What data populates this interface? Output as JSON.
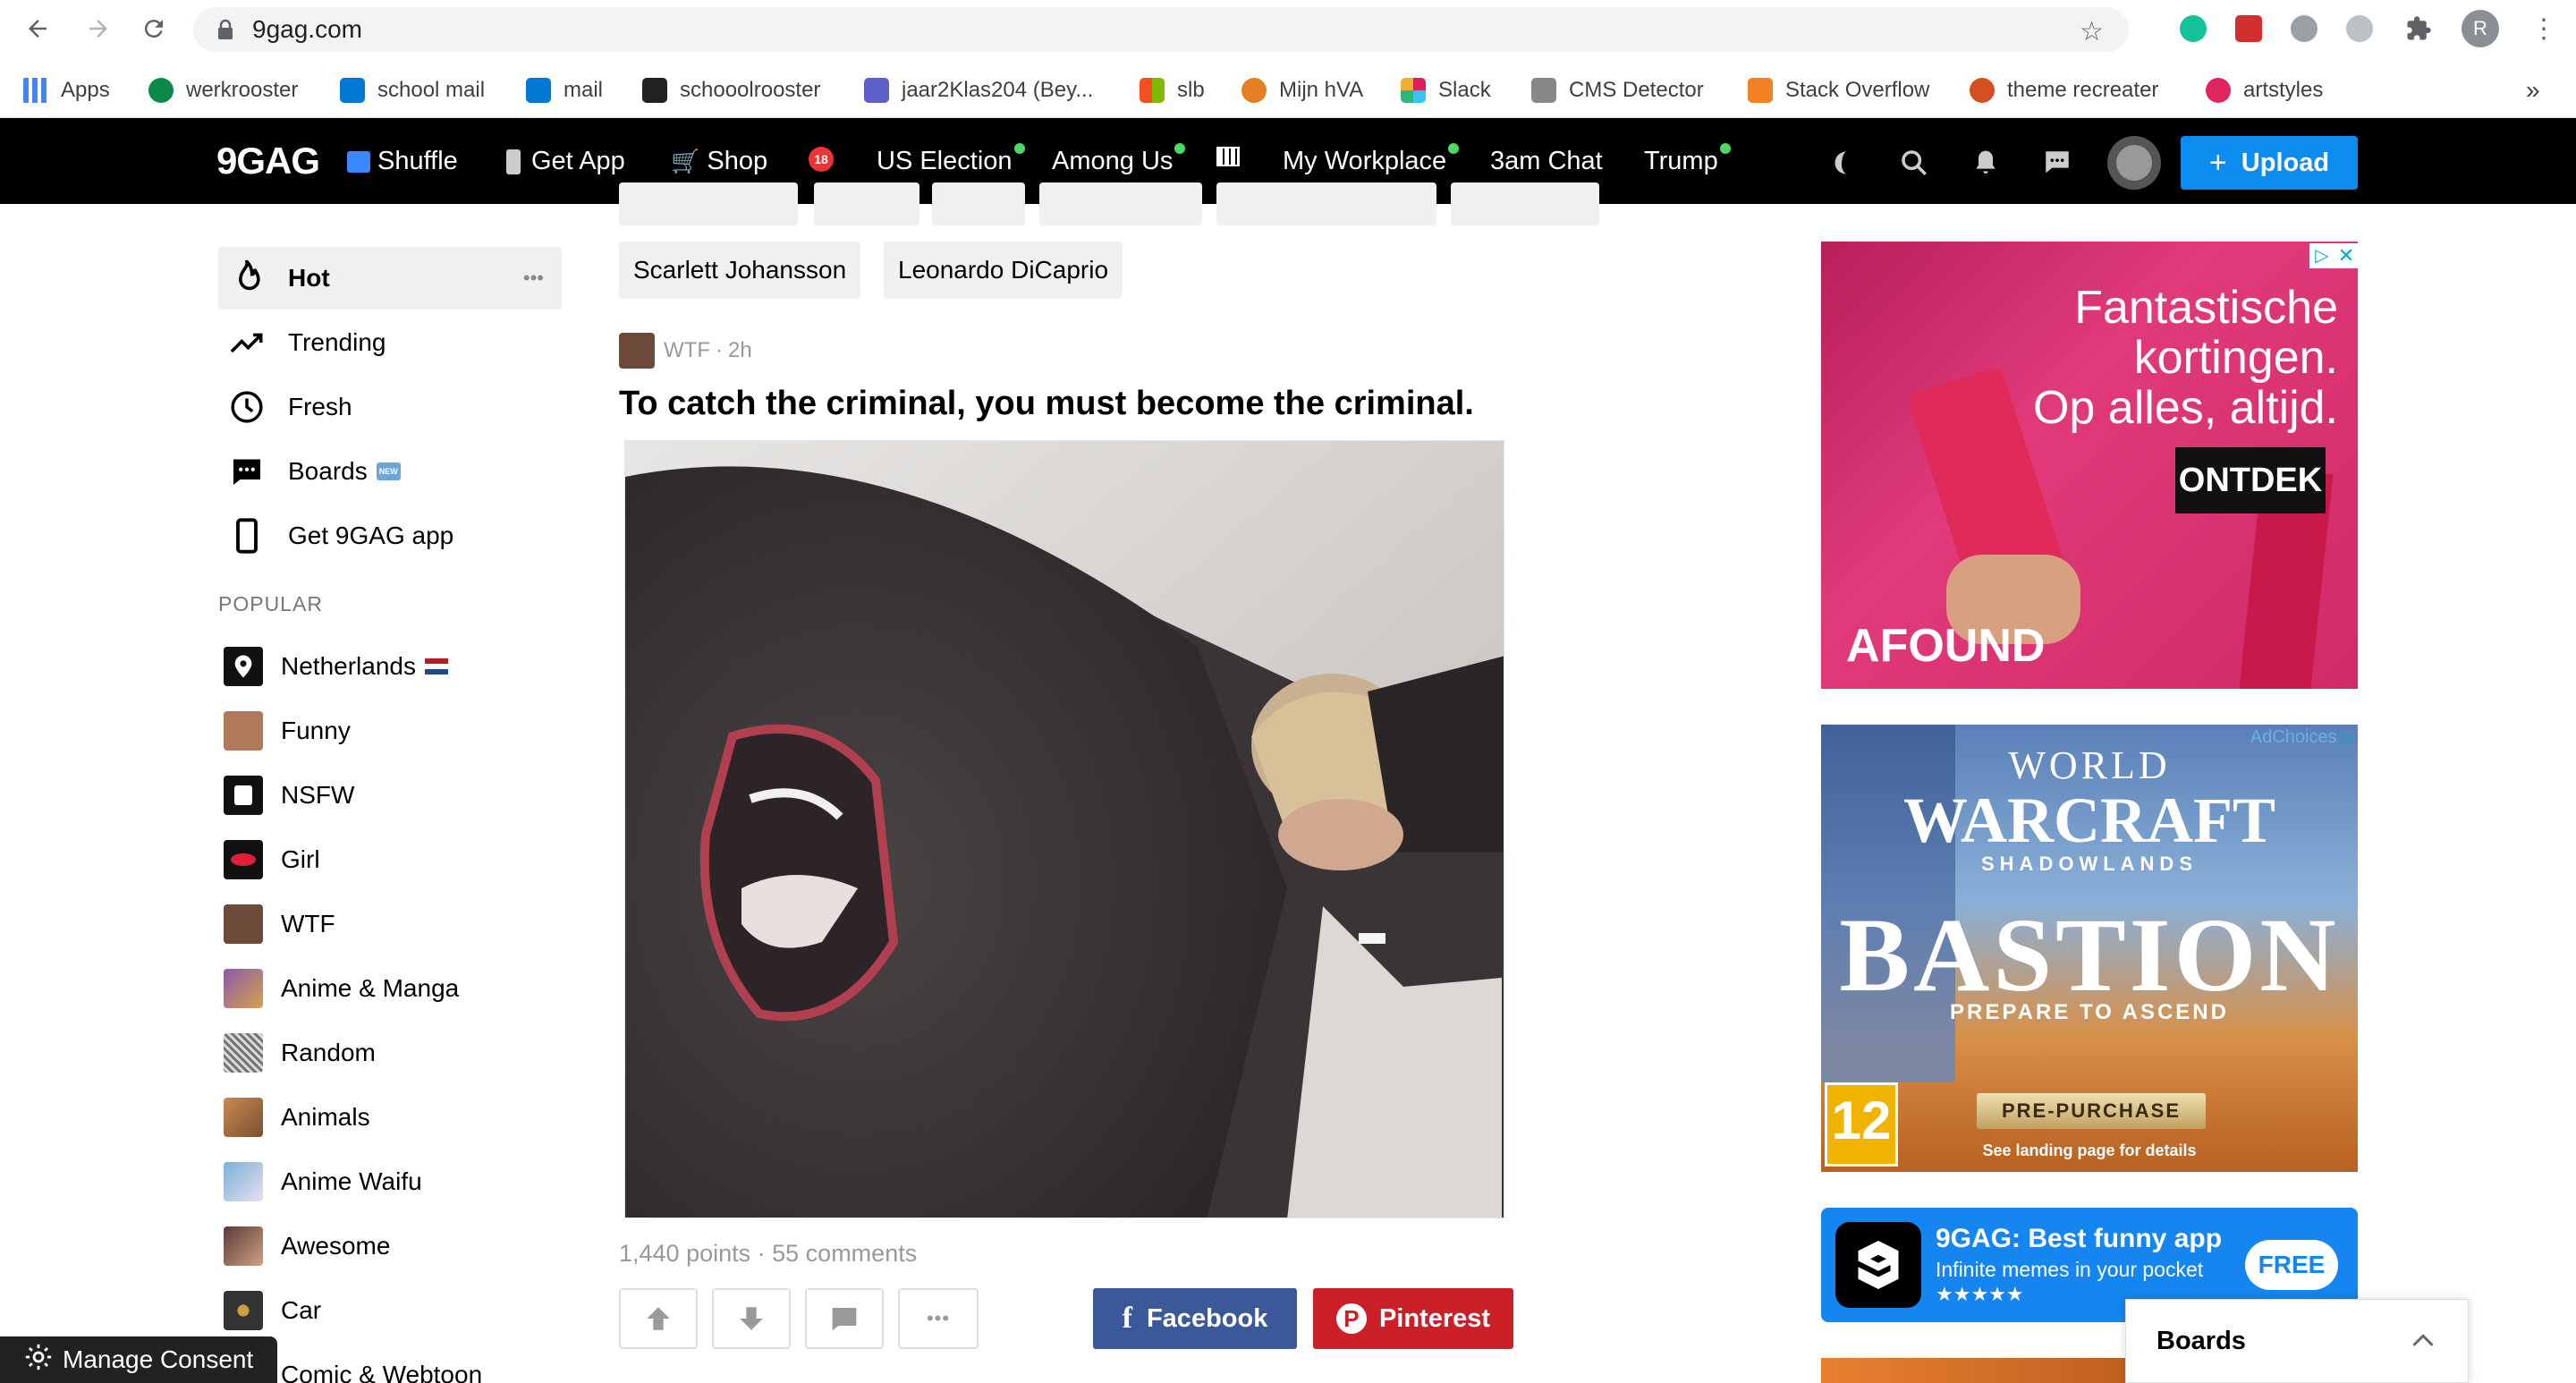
{
  "browser": {
    "url": "9gag.com",
    "profile_initial": "R",
    "bookmarks": [
      {
        "label": "Apps",
        "color": "#4285f4"
      },
      {
        "label": "werkrooster",
        "color": "#0a8a4a"
      },
      {
        "label": "school mail",
        "color": "#0078d4"
      },
      {
        "label": "mail",
        "color": "#0078d4"
      },
      {
        "label": "schooolrooster",
        "color": "#222222"
      },
      {
        "label": "jaar2Klas204 (Bey...",
        "color": "#5b5fc7"
      },
      {
        "label": "slb",
        "color": "#f25022"
      },
      {
        "label": "Mijn hVA",
        "color": "#e67e22"
      },
      {
        "label": "Slack",
        "color": "#e01e5a"
      },
      {
        "label": "CMS Detector",
        "color": "#555555"
      },
      {
        "label": "Stack Overflow",
        "color": "#f48024"
      },
      {
        "label": "theme recreater",
        "color": "#d54e21"
      },
      {
        "label": "artstyles",
        "color": "#e0245e"
      }
    ],
    "more_bookmarks": "»"
  },
  "header": {
    "logo": "9GAG",
    "nav": [
      {
        "label": "Shuffle",
        "icon": "shuffle-icon",
        "dot": false
      },
      {
        "label": "Get App",
        "icon": "phone-icon",
        "dot": false
      },
      {
        "label": "Shop",
        "icon": "cart-icon",
        "dot": false
      },
      {
        "label": "",
        "icon": "18-icon",
        "dot": false
      },
      {
        "label": "US Election",
        "icon": "",
        "dot": true
      },
      {
        "label": "Among Us",
        "icon": "",
        "dot": true
      },
      {
        "label": "",
        "icon": "piano-icon",
        "dot": false
      },
      {
        "label": "My Workplace",
        "icon": "",
        "dot": true
      },
      {
        "label": "3am Chat",
        "icon": "",
        "dot": false
      },
      {
        "label": "Trump",
        "icon": "",
        "dot": true
      }
    ],
    "upload_label": "Upload"
  },
  "sidebar": {
    "main": [
      {
        "label": "Hot",
        "icon": "fire-icon",
        "active": true
      },
      {
        "label": "Trending",
        "icon": "trending-icon",
        "active": false
      },
      {
        "label": "Fresh",
        "icon": "clock-icon",
        "active": false
      },
      {
        "label": "Boards",
        "icon": "chat-icon",
        "active": false,
        "badge": "NEW"
      },
      {
        "label": "Get 9GAG app",
        "icon": "phone-icon",
        "active": false
      }
    ],
    "more_label": "•••",
    "popular_heading": "POPULAR",
    "popular": [
      {
        "label": "Netherlands",
        "color": "#111111",
        "flag": true
      },
      {
        "label": "Funny",
        "color": "#b07a5a"
      },
      {
        "label": "NSFW",
        "color": "#111111"
      },
      {
        "label": "Girl",
        "color": "#111111"
      },
      {
        "label": "WTF",
        "color": "#6b4a3a"
      },
      {
        "label": "Anime & Manga",
        "color": "#8a5aa8"
      },
      {
        "label": "Random",
        "color": "#999999"
      },
      {
        "label": "Animals",
        "color": "#c88a50"
      },
      {
        "label": "Anime Waifu",
        "color": "#7ab0d8"
      },
      {
        "label": "Awesome",
        "color": "#5a3a3a"
      },
      {
        "label": "Car",
        "color": "#333333"
      },
      {
        "label": "Comic & Webtoon",
        "color": "#444444"
      }
    ]
  },
  "tags": {
    "row1": [
      "Scarlett Johansson",
      "Leonardo DiCaprio"
    ]
  },
  "post": {
    "section": "WTF",
    "age": "2h",
    "title": "To catch the criminal, you must become the criminal.",
    "points": "1,440 points",
    "comments": "55 comments",
    "facebook_label": "Facebook",
    "pinterest_label": "Pinterest"
  },
  "ads": {
    "afound": {
      "headline1": "Fantastische",
      "headline2": "kortingen.",
      "headline3": "Op alles, altijd.",
      "cta": "ONTDEK",
      "brand": "AFOUND"
    },
    "wow": {
      "adchoices": "AdChoices",
      "world": "WORLD",
      "warcraft": "WARCRAFT",
      "shadowlands": "SHADOWLANDS",
      "bastion": "BASTION",
      "prepare": "PREPARE TO ASCEND",
      "rating": "12",
      "prepurchase": "PRE-PURCHASE",
      "details": "See landing page for details"
    },
    "app": {
      "title": "9GAG: Best funny app",
      "subtitle": "Infinite memes in your pocket",
      "stars": "★★★★★",
      "cta": "FREE"
    }
  },
  "boards_popup": {
    "label": "Boards"
  },
  "consent": {
    "label": "Manage Consent"
  }
}
